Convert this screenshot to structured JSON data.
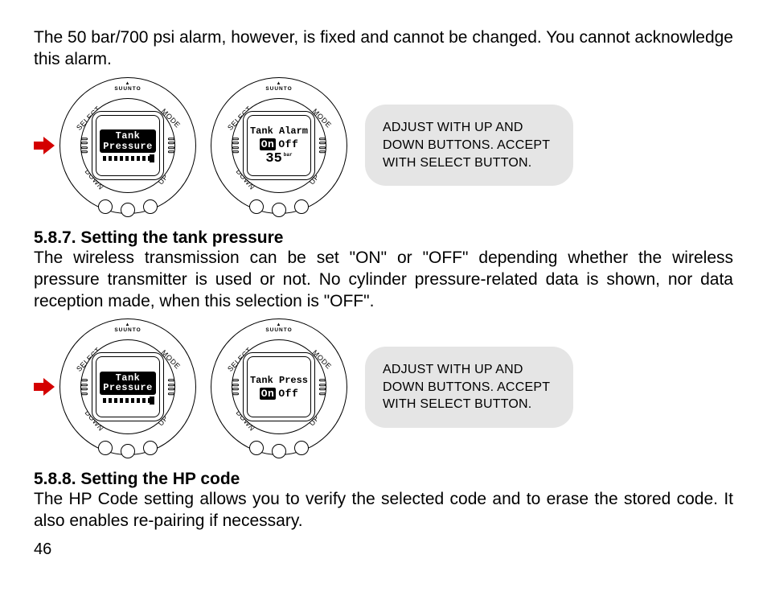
{
  "watch": {
    "brand": "SUUNTO",
    "labels": {
      "select": "SELECT",
      "mode": "MODE",
      "down": "DOWN",
      "up": "UP"
    }
  },
  "intro_para": "The 50 bar/700 psi alarm, however, is fixed and cannot be changed. You cannot acknowledge this alarm.",
  "fig1": {
    "screen1_line1": "Tank",
    "screen1_line2": "Pressure",
    "screen2_title": "Tank Alarm",
    "screen2_on": "On",
    "screen2_off": "Off",
    "screen2_unit": "bar",
    "screen2_value": "35",
    "callout": "ADJUST WITH UP AND DOWN BUTTONS. ACCEPT WITH SELECT BUTTON."
  },
  "section587": {
    "heading": "5.8.7. Setting the tank pressure",
    "para": "The wireless transmission can be set \"ON\" or \"OFF\" depending whether the wireless pressure transmitter is used or not. No cylinder pressure-related data is shown, nor data reception made, when this selection is \"OFF\"."
  },
  "fig2": {
    "screen1_line1": "Tank",
    "screen1_line2": "Pressure",
    "screen2_title": "Tank Press",
    "screen2_on": "On",
    "screen2_off": "Off",
    "callout": "ADJUST WITH UP AND DOWN BUTTONS. ACCEPT WITH SELECT BUTTON."
  },
  "section588": {
    "heading": "5.8.8. Setting the HP code",
    "para": "The HP Code setting allows you to verify the selected code and to erase the stored code. It also enables re-pairing if necessary."
  },
  "page_number": "46"
}
